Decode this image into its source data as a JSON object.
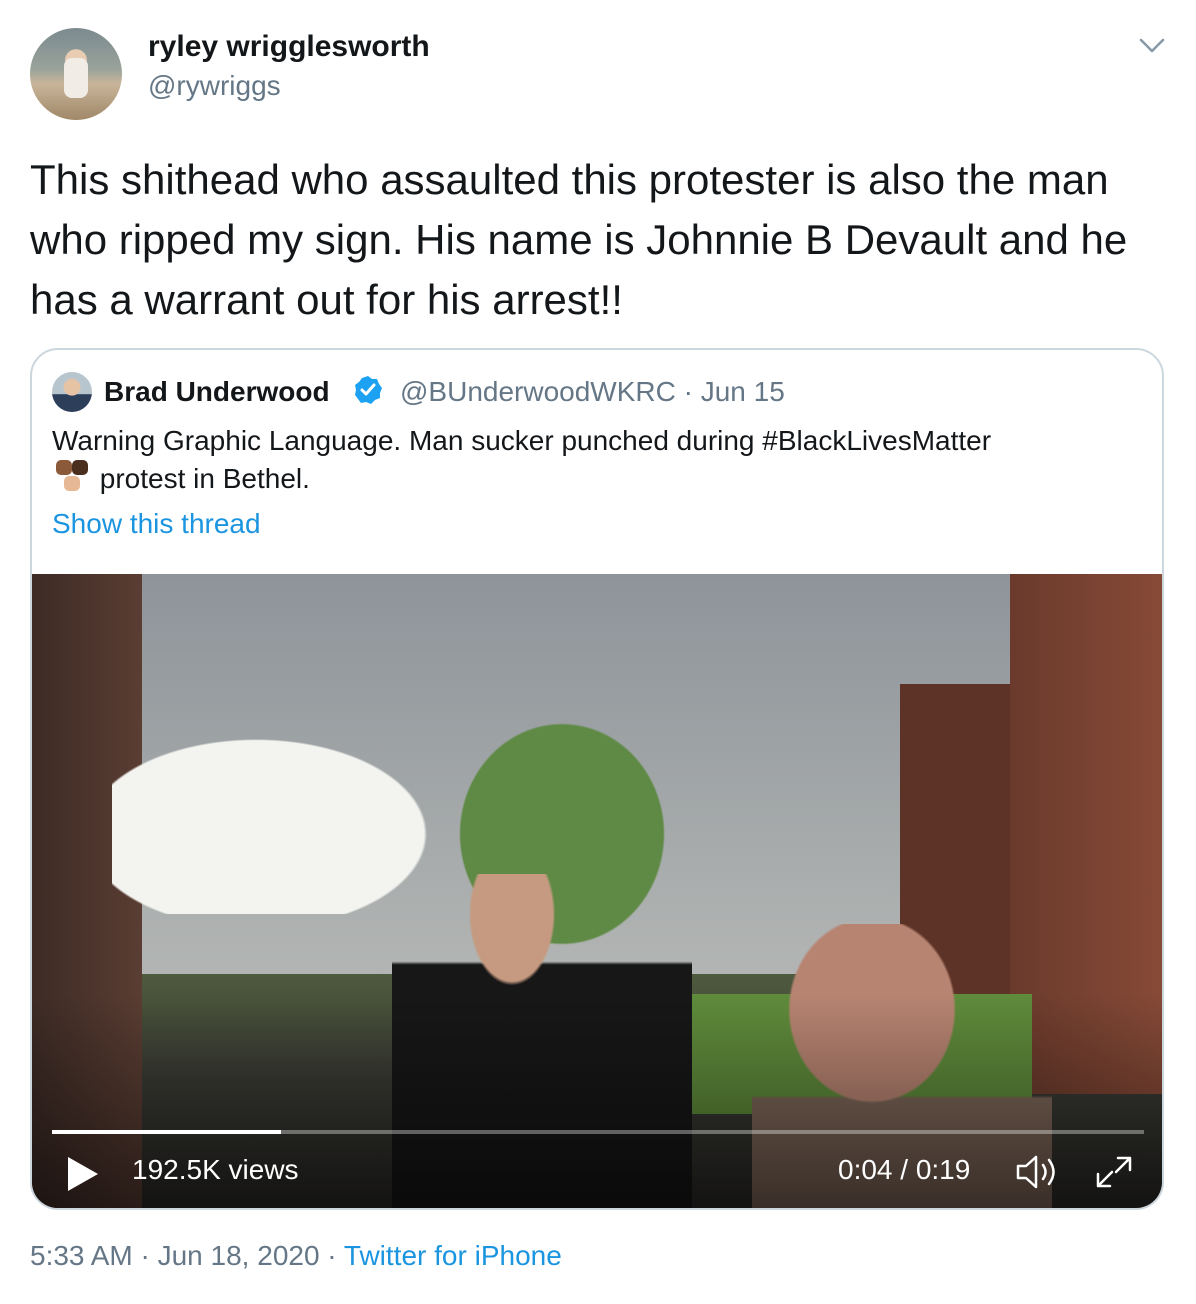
{
  "author": {
    "display_name": "ryley wrigglesworth",
    "handle": "@rywriggs"
  },
  "tweet": {
    "text": "This shithead who assaulted this protester is also the man who ripped my sign. His name is Johnnie B Devault and he has a warrant out for his arrest!!",
    "timestamp": "5:33 AM · Jun 18, 2020 · ",
    "source": "Twitter for iPhone"
  },
  "quoted_tweet": {
    "display_name": "Brad Underwood",
    "handle_date": "@BUnderwoodWKRC · Jun 15",
    "text_before_emoji": "Warning Graphic Language. Man sucker punched during #BlackLivesMatter",
    "text_after_emoji": " protest in Bethel.",
    "show_thread": "Show this thread",
    "emoji_name": "raised-fists-emoji"
  },
  "video": {
    "views": "192.5K views",
    "time": "0:04 / 0:19",
    "progress": 0.21,
    "play_icon": "play-icon",
    "volume_icon": "volume-icon",
    "fullscreen_icon": "fullscreen-icon"
  },
  "colors": {
    "link": "#1b95e0",
    "muted": "#657786",
    "verified": "#1da1f2",
    "border": "#ccd6dd"
  },
  "icons": {
    "caret": "chevron-down-icon",
    "verified": "verified-badge-icon"
  }
}
